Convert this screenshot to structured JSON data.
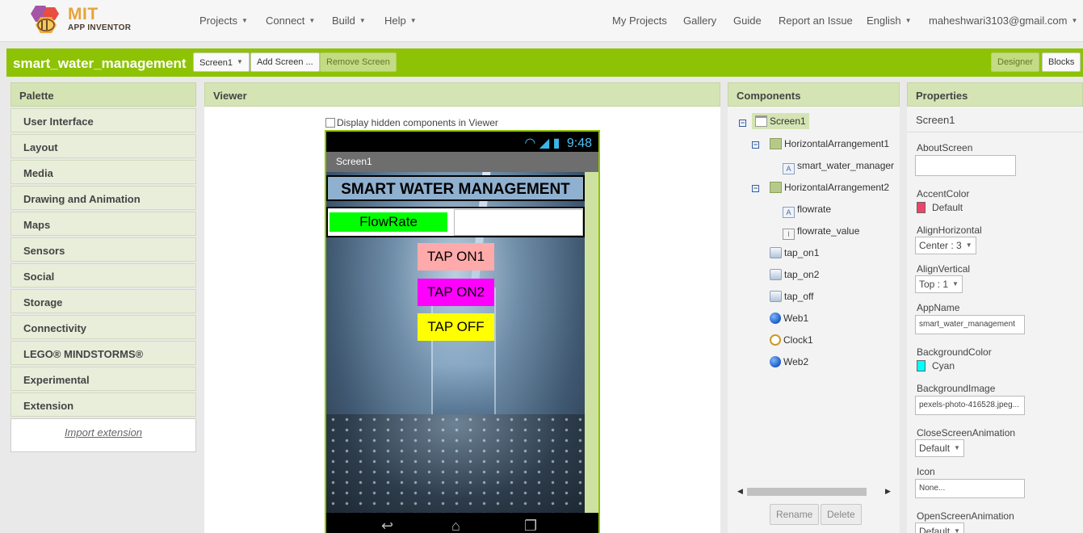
{
  "top_nav": {
    "logo_mit": "MIT",
    "logo_sub": "APP INVENTOR",
    "menu": [
      {
        "label": "Projects"
      },
      {
        "label": "Connect"
      },
      {
        "label": "Build"
      },
      {
        "label": "Help"
      }
    ],
    "links": {
      "my_projects": "My Projects",
      "gallery": "Gallery",
      "guide": "Guide",
      "report": "Report an Issue",
      "language": "English",
      "account": "maheshwari3103@gmail.com"
    }
  },
  "project_bar": {
    "project_name": "smart_water_management",
    "screen_select": "Screen1",
    "add_screen": "Add Screen ...",
    "remove_screen": "Remove Screen",
    "designer": "Designer",
    "blocks": "Blocks"
  },
  "palette": {
    "title": "Palette",
    "items": [
      "User Interface",
      "Layout",
      "Media",
      "Drawing and Animation",
      "Maps",
      "Sensors",
      "Social",
      "Storage",
      "Connectivity",
      "LEGO® MINDSTORMS®",
      "Experimental",
      "Extension"
    ],
    "import_extension": "Import extension"
  },
  "viewer": {
    "title": "Viewer",
    "hidden_components_label": "Display hidden components in Viewer",
    "phone": {
      "time": "9:48",
      "screen_title": "Screen1",
      "banner": "SMART WATER MANAGEMENT",
      "flow_label": "FlowRate",
      "buttons": {
        "tap_on1": "TAP ON1",
        "tap_on2": "TAP ON2",
        "tap_off": "TAP OFF"
      }
    },
    "colors": {
      "flow_label_bg": "#00ff00",
      "tap_on1_bg": "#ffaaaa",
      "tap_on2_bg": "#ff00ff",
      "tap_off_bg": "#ffff00"
    }
  },
  "components": {
    "title": "Components",
    "tree": {
      "screen1": "Screen1",
      "harr1": "HorizontalArrangement1",
      "label1": "smart_water_manager",
      "harr2": "HorizontalArrangement2",
      "flowrate": "flowrate",
      "flowrate_value": "flowrate_value",
      "tap_on1": "tap_on1",
      "tap_on2": "tap_on2",
      "tap_off": "tap_off",
      "web1": "Web1",
      "clock1": "Clock1",
      "web2": "Web2"
    },
    "rename": "Rename",
    "delete": "Delete"
  },
  "properties": {
    "title": "Properties",
    "component": "Screen1",
    "about_screen": {
      "label": "AboutScreen",
      "value": ""
    },
    "accent_color": {
      "label": "AccentColor",
      "value": "Default",
      "swatch": "#ee4466"
    },
    "align_horizontal": {
      "label": "AlignHorizontal",
      "value": "Center : 3"
    },
    "align_vertical": {
      "label": "AlignVertical",
      "value": "Top : 1"
    },
    "app_name": {
      "label": "AppName",
      "value": "smart_water_management"
    },
    "background_color": {
      "label": "BackgroundColor",
      "value": "Cyan",
      "swatch": "#00ffff"
    },
    "background_image": {
      "label": "BackgroundImage",
      "value": "pexels-photo-416528.jpeg..."
    },
    "close_screen_animation": {
      "label": "CloseScreenAnimation",
      "value": "Default"
    },
    "icon": {
      "label": "Icon",
      "value": "None..."
    },
    "open_screen_animation": {
      "label": "OpenScreenAnimation",
      "value": "Default"
    }
  }
}
